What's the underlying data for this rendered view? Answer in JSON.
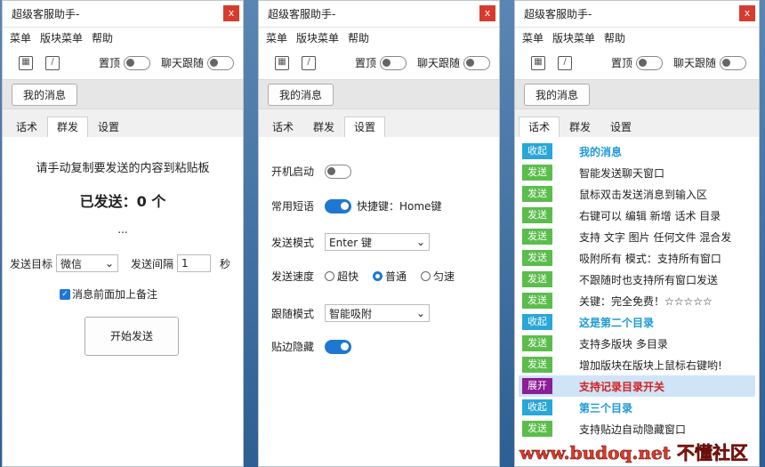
{
  "app_title": "超级客服助手-",
  "close_glyph": "x",
  "menu": [
    "菜单",
    "版块菜单",
    "帮助"
  ],
  "toolbar": {
    "pin_label": "置顶",
    "follow_label": "聊天跟随",
    "calc_icon": "calculator-icon",
    "edit_icon": "edit-icon"
  },
  "my_messages_btn": "我的消息",
  "tabs": [
    "话术",
    "群发",
    "设置"
  ],
  "mass": {
    "instruction": "请手动复制要发送的内容到粘贴板",
    "sent_label": "已发送：0 个",
    "ellipsis": "...",
    "target_label": "发送目标",
    "target_value": "微信",
    "interval_label": "发送间隔",
    "interval_value": "1",
    "interval_unit": "秒",
    "remark_label": "消息前面加上备注",
    "start_btn": "开始发送"
  },
  "settings": {
    "startup_label": "开机启动",
    "phrase_label": "常用短语",
    "hotkey_label": "快捷键：Home键",
    "send_mode_label": "发送模式",
    "send_mode_value": "Enter 键",
    "speed_label": "发送速度",
    "speed_options": [
      "超快",
      "普通",
      "匀速"
    ],
    "follow_mode_label": "跟随模式",
    "follow_mode_value": "智能吸附",
    "edge_hide_label": "贴边隐藏"
  },
  "phrases": [
    {
      "badge": "收起",
      "type": "fold",
      "text": "我的消息",
      "style": "dir"
    },
    {
      "badge": "发送",
      "type": "send",
      "text": "智能发送聊天窗口"
    },
    {
      "badge": "发送",
      "type": "send",
      "text": "鼠标双击发送消息到输入区"
    },
    {
      "badge": "发送",
      "type": "send",
      "text": "右键可以 编辑 新增 话术 目录"
    },
    {
      "badge": "发送",
      "type": "send",
      "text": "支持 文字 图片 任何文件 混合发"
    },
    {
      "badge": "发送",
      "type": "send",
      "text": "吸附所有 模式：支持所有窗口"
    },
    {
      "badge": "发送",
      "type": "send",
      "text": "不跟随时也支持所有窗口发送"
    },
    {
      "badge": "发送",
      "type": "send",
      "text": "关键：完全免费！☆☆☆☆☆"
    },
    {
      "badge": "收起",
      "type": "fold",
      "text": "这是第二个目录",
      "style": "dir"
    },
    {
      "badge": "发送",
      "type": "send",
      "text": "支持多版块 多目录"
    },
    {
      "badge": "发送",
      "type": "send",
      "text": "增加版块在版块上鼠标右键哟!"
    },
    {
      "badge": "展开",
      "type": "open",
      "text": "支持记录目录开关",
      "style": "red",
      "highlight": true
    },
    {
      "badge": "收起",
      "type": "fold",
      "text": "第三个目录",
      "style": "dir"
    },
    {
      "badge": "发送",
      "type": "send",
      "text": "支持贴边自动隐藏窗口"
    }
  ],
  "watermark": "www.budoq.net 不懂社区"
}
